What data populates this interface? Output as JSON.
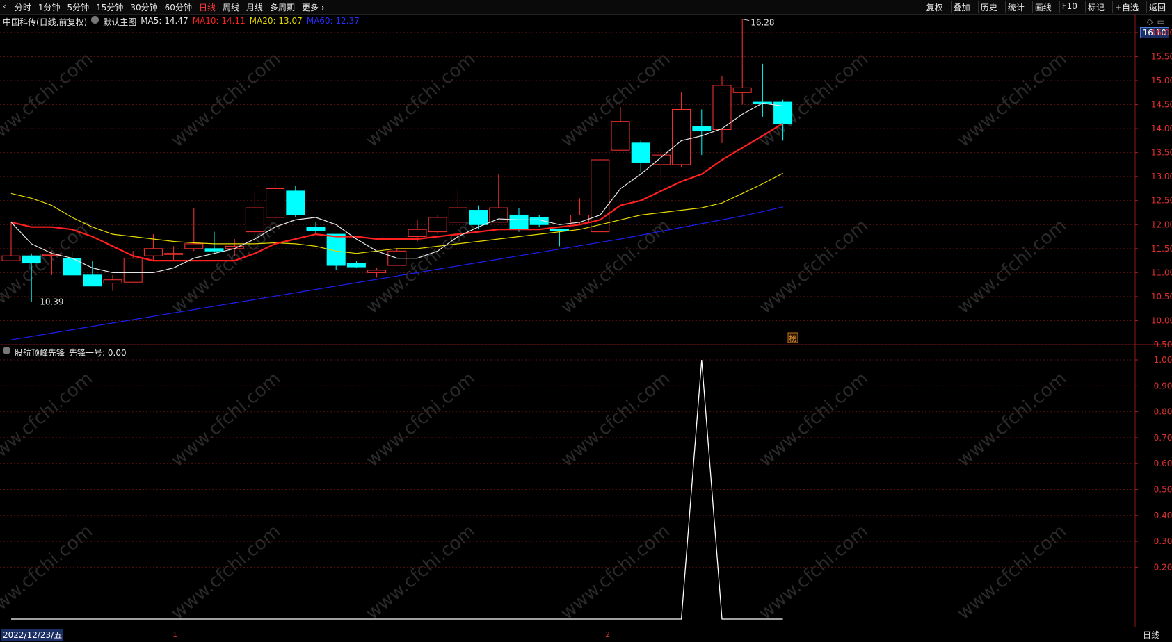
{
  "toolbar": {
    "periods": [
      "分时",
      "1分钟",
      "5分钟",
      "15分钟",
      "30分钟",
      "60分钟",
      "日线",
      "周线",
      "月线",
      "多周期",
      "更多"
    ],
    "active_period": "日线",
    "more_suffix": "›",
    "right_buttons": [
      "复权",
      "叠加",
      "历史",
      "统计",
      "画线",
      "F10",
      "标记",
      "+自选",
      "返回"
    ]
  },
  "main": {
    "stock_label": "中国科传(日线,前复权)",
    "template_label": "默认主图",
    "ma5": "MA5: 14.47",
    "ma10": "MA10: 14.11",
    "ma20": "MA20: 13.07",
    "ma60": "MA60: 12.37",
    "colors": {
      "ma5": "#e6e6e6",
      "ma10": "#ff2020",
      "ma20": "#e6d800",
      "ma60": "#1e1ef0",
      "up": "#ff3333",
      "down": "#00ffff"
    },
    "current_price": "16.10",
    "high_label": "16.28",
    "low_label": "10.39",
    "event_marker": "榜",
    "y_axis": [
      "16.00",
      "15.50",
      "15.00",
      "14.50",
      "14.00",
      "13.50",
      "13.00",
      "12.50",
      "12.00",
      "11.50",
      "11.00",
      "10.50",
      "10.00",
      "9.50"
    ]
  },
  "indicator": {
    "name": "股航顶峰先锋",
    "series_value": "先锋一号: 0.00",
    "y_axis": [
      "1.00",
      "0.90",
      "0.80",
      "0.70",
      "0.60",
      "0.50",
      "0.40",
      "0.30",
      "0.20"
    ]
  },
  "footer": {
    "date": "2022/12/23/五",
    "marker1": "1",
    "marker2": "2",
    "period_tab": "日线"
  },
  "watermark": "www.cfchi.com",
  "chart_data": {
    "type": "candlestick",
    "candles": [
      {
        "o": 11.25,
        "c": 11.35,
        "h": 12.05,
        "l": 11.25
      },
      {
        "o": 11.35,
        "c": 11.2,
        "h": 11.4,
        "l": 10.39
      },
      {
        "o": 11.38,
        "c": 11.38,
        "h": 11.45,
        "l": 10.95
      },
      {
        "o": 11.3,
        "c": 10.95,
        "h": 11.45,
        "l": 10.95
      },
      {
        "o": 10.95,
        "c": 10.72,
        "h": 11.25,
        "l": 10.72
      },
      {
        "o": 10.78,
        "c": 10.85,
        "h": 10.95,
        "l": 10.62
      },
      {
        "o": 10.8,
        "c": 11.3,
        "h": 11.45,
        "l": 10.8
      },
      {
        "o": 11.35,
        "c": 11.5,
        "h": 11.8,
        "l": 11.25
      },
      {
        "o": 11.38,
        "c": 11.4,
        "h": 11.55,
        "l": 11.25
      },
      {
        "o": 11.5,
        "c": 11.6,
        "h": 12.35,
        "l": 11.45
      },
      {
        "o": 11.5,
        "c": 11.45,
        "h": 11.85,
        "l": 11.4
      },
      {
        "o": 11.5,
        "c": 11.55,
        "h": 11.7,
        "l": 11.35
      },
      {
        "o": 11.85,
        "c": 12.35,
        "h": 12.7,
        "l": 11.6
      },
      {
        "o": 12.15,
        "c": 12.75,
        "h": 12.95,
        "l": 12.1
      },
      {
        "o": 12.7,
        "c": 12.2,
        "h": 12.8,
        "l": 12.15
      },
      {
        "o": 11.95,
        "c": 11.88,
        "h": 12.05,
        "l": 11.8
      },
      {
        "o": 11.8,
        "c": 11.15,
        "h": 11.8,
        "l": 11.05
      },
      {
        "o": 11.2,
        "c": 11.12,
        "h": 11.25,
        "l": 11.1
      },
      {
        "o": 11.0,
        "c": 11.05,
        "h": 11.1,
        "l": 10.9
      },
      {
        "o": 11.15,
        "c": 11.45,
        "h": 11.5,
        "l": 11.15
      },
      {
        "o": 11.75,
        "c": 11.9,
        "h": 12.1,
        "l": 11.65
      },
      {
        "o": 11.85,
        "c": 12.15,
        "h": 12.2,
        "l": 11.8
      },
      {
        "o": 12.05,
        "c": 12.35,
        "h": 12.75,
        "l": 12.05
      },
      {
        "o": 12.3,
        "c": 12.0,
        "h": 12.4,
        "l": 11.9
      },
      {
        "o": 12.05,
        "c": 12.35,
        "h": 13.05,
        "l": 12.05
      },
      {
        "o": 12.2,
        "c": 11.9,
        "h": 12.35,
        "l": 11.85
      },
      {
        "o": 12.15,
        "c": 12.0,
        "h": 12.2,
        "l": 11.95
      },
      {
        "o": 11.9,
        "c": 11.88,
        "h": 11.92,
        "l": 11.55
      },
      {
        "o": 12.05,
        "c": 12.2,
        "h": 12.55,
        "l": 12.0
      },
      {
        "o": 11.85,
        "c": 13.35,
        "h": 13.35,
        "l": 11.85
      },
      {
        "o": 13.55,
        "c": 14.15,
        "h": 14.45,
        "l": 13.55
      },
      {
        "o": 13.7,
        "c": 13.3,
        "h": 13.75,
        "l": 13.1
      },
      {
        "o": 13.25,
        "c": 13.45,
        "h": 13.6,
        "l": 12.9
      },
      {
        "o": 13.25,
        "c": 14.4,
        "h": 14.75,
        "l": 13.2
      },
      {
        "o": 14.05,
        "c": 13.95,
        "h": 14.4,
        "l": 13.45
      },
      {
        "o": 13.98,
        "c": 14.9,
        "h": 15.1,
        "l": 13.7
      },
      {
        "o": 14.75,
        "c": 14.85,
        "h": 16.28,
        "l": 14.5
      },
      {
        "o": 14.55,
        "c": 14.53,
        "h": 15.35,
        "l": 14.25
      },
      {
        "o": 14.55,
        "c": 14.1,
        "h": 14.6,
        "l": 13.75
      }
    ],
    "ma5": [
      12.05,
      11.6,
      11.4,
      11.3,
      11.1,
      11.0,
      11.0,
      11.0,
      11.1,
      11.3,
      11.4,
      11.5,
      11.7,
      11.95,
      12.1,
      12.15,
      12.0,
      11.7,
      11.45,
      11.3,
      11.3,
      11.45,
      11.75,
      11.95,
      12.12,
      12.1,
      12.1,
      12.0,
      12.05,
      12.2,
      12.75,
      13.05,
      13.4,
      13.75,
      13.85,
      14.0,
      14.3,
      14.53,
      14.47
    ],
    "ma10": [
      12.05,
      11.95,
      11.95,
      11.9,
      11.75,
      11.55,
      11.35,
      11.25,
      11.25,
      11.25,
      11.25,
      11.25,
      11.4,
      11.6,
      11.7,
      11.8,
      11.75,
      11.75,
      11.7,
      11.7,
      11.7,
      11.75,
      11.8,
      11.85,
      11.9,
      11.9,
      11.9,
      11.95,
      12.0,
      12.1,
      12.4,
      12.5,
      12.7,
      12.9,
      13.05,
      13.35,
      13.6,
      13.85,
      14.11
    ],
    "ma20": [
      12.65,
      12.55,
      12.4,
      12.15,
      11.95,
      11.8,
      11.75,
      11.7,
      11.65,
      11.62,
      11.6,
      11.6,
      11.6,
      11.62,
      11.6,
      11.55,
      11.45,
      11.4,
      11.45,
      11.5,
      11.5,
      11.55,
      11.6,
      11.65,
      11.7,
      11.75,
      11.8,
      11.85,
      11.9,
      12.0,
      12.1,
      12.2,
      12.25,
      12.3,
      12.35,
      12.45,
      12.65,
      12.85,
      13.07
    ],
    "ma60": [
      9.6,
      9.67,
      9.74,
      9.81,
      9.88,
      9.95,
      10.02,
      10.09,
      10.16,
      10.23,
      10.3,
      10.37,
      10.44,
      10.51,
      10.58,
      10.65,
      10.72,
      10.79,
      10.86,
      10.93,
      11.0,
      11.07,
      11.14,
      11.21,
      11.28,
      11.35,
      11.42,
      11.49,
      11.56,
      11.63,
      11.7,
      11.78,
      11.86,
      11.94,
      12.02,
      12.1,
      12.18,
      12.27,
      12.37
    ],
    "ylim": [
      9.5,
      16.1
    ],
    "indicator_series": {
      "name": "先锋一号",
      "values": [
        0,
        0,
        0,
        0,
        0,
        0,
        0,
        0,
        0,
        0,
        0,
        0,
        0,
        0,
        0,
        0,
        0,
        0,
        0,
        0,
        0,
        0,
        0,
        0,
        0,
        0,
        0,
        0,
        0,
        0,
        0,
        0,
        0,
        0,
        1,
        0,
        0,
        0,
        0
      ],
      "ylim": [
        0,
        1
      ]
    }
  }
}
